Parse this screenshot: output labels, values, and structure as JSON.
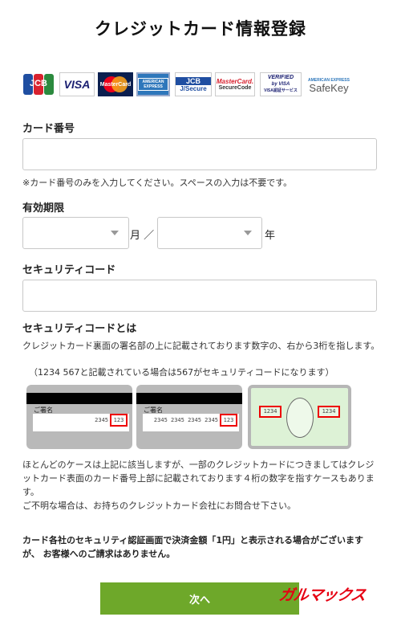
{
  "header": {
    "title": "クレジットカード情報登録"
  },
  "brands": {
    "jcb": "JCB",
    "visa": "VISA",
    "mastercard": "MasterCard",
    "amex": "AMERICAN EXPRESS",
    "jsecure_top": "JCB",
    "jsecure_bottom": "J/Secure",
    "mc_securecode_top": "MasterCard.",
    "mc_securecode_bottom": "SecureCode",
    "verified_top": "VERIFIED",
    "verified_mid": "by VISA",
    "verified_bottom": "VISA認証サービス",
    "safekey_top": "AMERICAN EXPRESS",
    "safekey_bottom": "SafeKey"
  },
  "card_number": {
    "label": "カード番号",
    "value": "",
    "note": "※カード番号のみを入力してください。スペースの入力は不要です。"
  },
  "expiry": {
    "label": "有効期限",
    "month_value": "",
    "month_unit": "月 ／",
    "year_value": "",
    "year_unit": "年"
  },
  "security_code": {
    "label": "セキュリティコード",
    "value": ""
  },
  "about": {
    "heading": "セキュリティコードとは",
    "line1": "クレジットカード裏面の署名部の上に記載されております数字の、右から3桁を指します。",
    "line2": "（1234 567と記載されている場合は567がセキュリティコードになります）"
  },
  "examples": {
    "card1_sig": "ご署名",
    "card1_nums": "2345",
    "card1_cvv": "123",
    "card2_sig": "ご署名",
    "card2_nums": "2345 2345 2345 2345",
    "card2_cvv": "123",
    "amex_left": "1234",
    "amex_right": "1234"
  },
  "notes": {
    "p1_line1": "ほとんどのケースは上記に該当しますが、一部のクレジットカードにつきましてはクレジ",
    "p1_line2": "ットカード表面のカード番号上部に記載されております４桁の数字を指すケースもありま",
    "p1_line3": "す。",
    "p2": "ご不明な場合は、お持ちのクレジットカード会社にお問合せ下さい。",
    "p3_line1": "カード各社のセキュリティ認証画面で決済金額「1円」と表示される場合がございます",
    "p3_line2": "が、 お客様へのご請求はありません。"
  },
  "actions": {
    "next_label": "次へ"
  },
  "watermark": {
    "text": "ガルマックス"
  },
  "colors": {
    "button": "#6ea82a",
    "highlight": "#e00000",
    "watermark": "#e60012"
  }
}
